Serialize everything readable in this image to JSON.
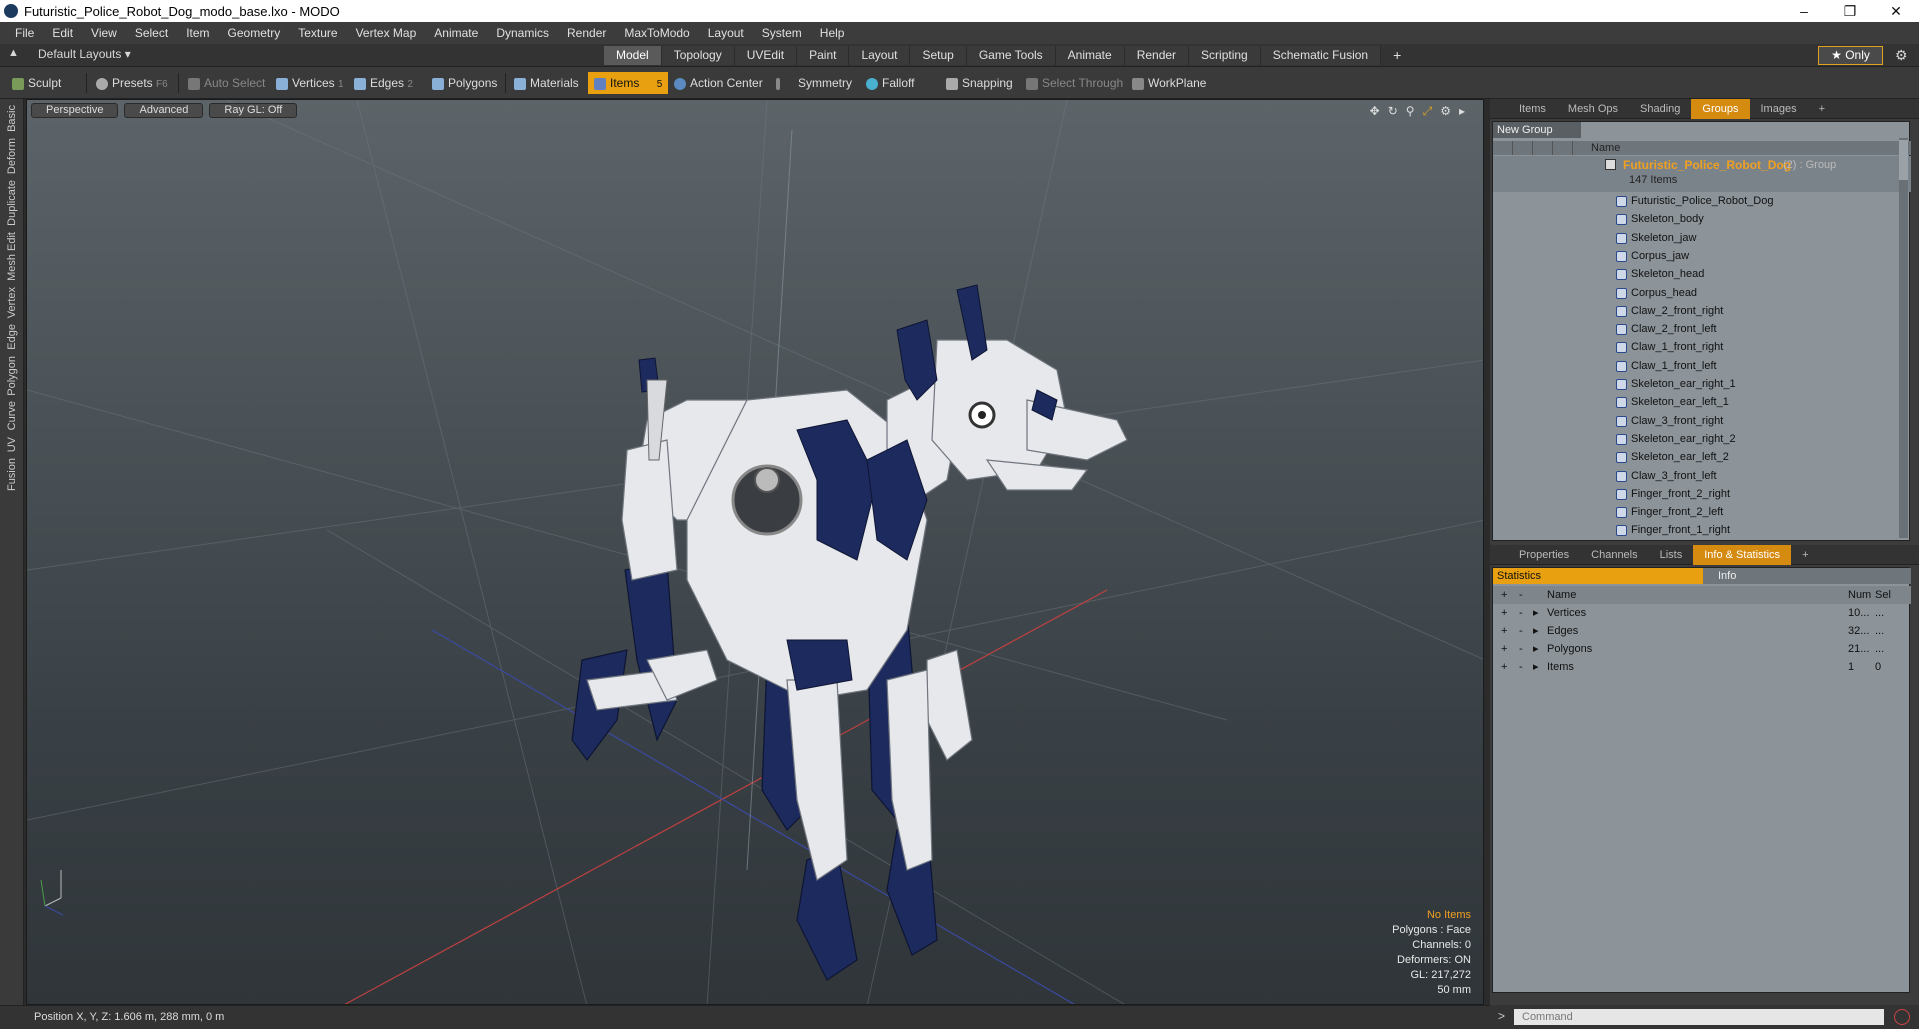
{
  "window": {
    "title": "Futuristic_Police_Robot_Dog_modo_base.lxo - MODO"
  },
  "menu": [
    "File",
    "Edit",
    "View",
    "Select",
    "Item",
    "Geometry",
    "Texture",
    "Vertex Map",
    "Animate",
    "Dynamics",
    "Render",
    "MaxToModo",
    "Layout",
    "System",
    "Help"
  ],
  "layout": {
    "default_label": "Default Layouts ▾",
    "tabs": [
      "Model",
      "Topology",
      "UVEdit",
      "Paint",
      "Layout",
      "Setup",
      "Game Tools",
      "Animate",
      "Render",
      "Scripting",
      "Schematic Fusion"
    ],
    "active_tab": "Model",
    "only_label": "★ Only"
  },
  "toolbar": {
    "sculpt": "Sculpt",
    "presets": "Presets",
    "presets_key": "F6",
    "auto_select": "Auto Select",
    "vertices": "Vertices",
    "vertices_n": "1",
    "edges": "Edges",
    "edges_n": "2",
    "polygons": "Polygons",
    "materials": "Materials",
    "items": "Items",
    "items_n": "5",
    "action_center": "Action Center",
    "symmetry": "Symmetry",
    "falloff": "Falloff",
    "snapping": "Snapping",
    "select_through": "Select Through",
    "workplane": "WorkPlane"
  },
  "left_strip": [
    "Basic",
    "Deform",
    "Duplicate",
    "Mesh Edit",
    "Vertex",
    "Edge",
    "Polygon",
    "Curve",
    "UV",
    "Fusion"
  ],
  "viewport": {
    "buttons": [
      "Perspective",
      "Advanced",
      "Ray GL: Off"
    ],
    "hud": {
      "no_items": "No Items",
      "polygons": "Polygons : Face",
      "channels": "Channels: 0",
      "deformers": "Deformers: ON",
      "gl": "GL: 217,272",
      "focal": "50 mm"
    }
  },
  "groups_panel": {
    "tabs": [
      "Items",
      "Mesh Ops",
      "Shading",
      "Groups",
      "Images"
    ],
    "active_tab": "Groups",
    "new_group": "New Group",
    "name_header": "Name",
    "group_name": "Futuristic_Police_Robot_Dog",
    "group_meta": "(2) : Group",
    "group_count": "147 Items",
    "items": [
      "Futuristic_Police_Robot_Dog",
      "Skeleton_body",
      "Skeleton_jaw",
      "Corpus_jaw",
      "Skeleton_head",
      "Corpus_head",
      "Claw_2_front_right",
      "Claw_2_front_left",
      "Claw_1_front_right",
      "Claw_1_front_left",
      "Skeleton_ear_right_1",
      "Skeleton_ear_left_1",
      "Claw_3_front_right",
      "Skeleton_ear_right_2",
      "Skeleton_ear_left_2",
      "Claw_3_front_left",
      "Finger_front_2_right",
      "Finger_front_2_left",
      "Finger_front_1_right"
    ]
  },
  "stats_panel": {
    "tabs": [
      "Properties",
      "Channels",
      "Lists",
      "Info & Statistics"
    ],
    "active_tab": "Info & Statistics",
    "statistics": "Statistics",
    "info": "Info",
    "headers": {
      "name": "Name",
      "num": "Num",
      "sel": "Sel"
    },
    "rows": [
      {
        "name": "Vertices",
        "num": "10...",
        "sel": "..."
      },
      {
        "name": "Edges",
        "num": "32...",
        "sel": "..."
      },
      {
        "name": "Polygons",
        "num": "21...",
        "sel": "..."
      },
      {
        "name": "Items",
        "num": "1",
        "sel": "0"
      }
    ]
  },
  "command": {
    "placeholder": "Command"
  },
  "status": {
    "position": "Position X, Y, Z:  1.606 m, 288 mm, 0 m"
  },
  "colors": {
    "accent": "#e8a010",
    "viewport_top": "#5c6469",
    "robot_blue": "#1c2a5e"
  }
}
